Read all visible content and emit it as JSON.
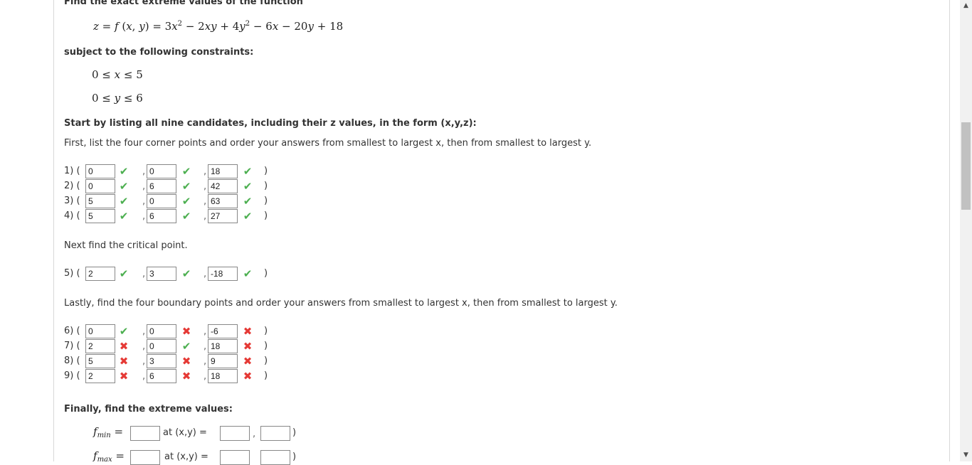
{
  "intro": "Find the exact extreme values of the function",
  "subject": "subject to the following constraints:",
  "start_text": "Start by listing all nine candidates, including their z values, in the form (x,y,z):",
  "corner_text": "First, list the four corner points and order your answers from smallest to largest x, then from smallest to largest y.",
  "critical_text": "Next find the critical point.",
  "boundary_text": "Lastly, find the four boundary points and order your answers from smallest to largest x, then from smallest to largest y.",
  "finally_text": "Finally, find the extreme values:",
  "at_xy": "at (x,y) =",
  "candidates": [
    {
      "label": "1) (",
      "x": "0",
      "xm": "ok",
      "y": "0",
      "ym": "ok",
      "z": "18",
      "zm": "ok"
    },
    {
      "label": "2) (",
      "x": "0",
      "xm": "ok",
      "y": "6",
      "ym": "ok",
      "z": "42",
      "zm": "ok"
    },
    {
      "label": "3) (",
      "x": "5",
      "xm": "ok",
      "y": "0",
      "ym": "ok",
      "z": "63",
      "zm": "ok"
    },
    {
      "label": "4) (",
      "x": "5",
      "xm": "ok",
      "y": "6",
      "ym": "ok",
      "z": "27",
      "zm": "ok"
    },
    {
      "label": "5) (",
      "x": "2",
      "xm": "ok",
      "y": "3",
      "ym": "ok",
      "z": "-18",
      "zm": "ok"
    },
    {
      "label": "6) (",
      "x": "0",
      "xm": "ok",
      "y": "0",
      "ym": "bad",
      "z": "-6",
      "zm": "bad"
    },
    {
      "label": "7) (",
      "x": "2",
      "xm": "bad",
      "y": "0",
      "ym": "ok",
      "z": "18",
      "zm": "bad"
    },
    {
      "label": "8) (",
      "x": "5",
      "xm": "bad",
      "y": "3",
      "ym": "bad",
      "z": "9",
      "zm": "bad"
    },
    {
      "label": "9) (",
      "x": "2",
      "xm": "bad",
      "y": "6",
      "ym": "bad",
      "z": "18",
      "zm": "bad"
    }
  ],
  "icons": {
    "ok": "checkmark-icon",
    "bad": "x-mark-icon",
    "up": "scroll-up-icon",
    "down": "scroll-down-icon"
  },
  "colors": {
    "ok": "#4caf50",
    "bad": "#e53935"
  }
}
